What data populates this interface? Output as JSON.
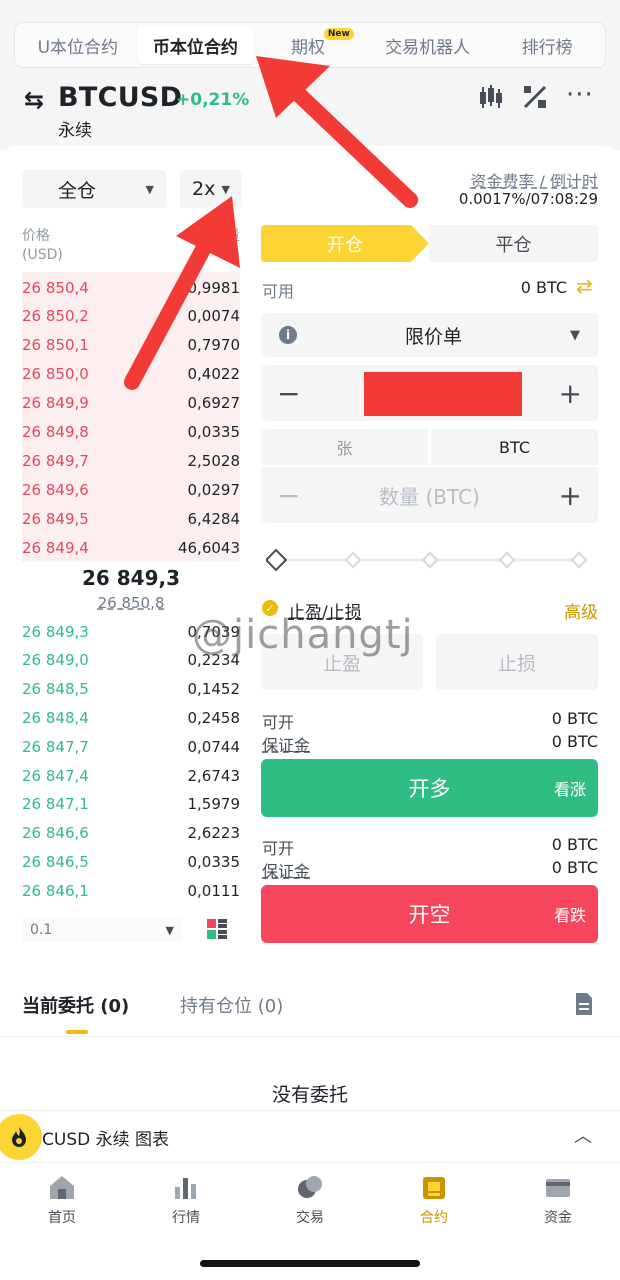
{
  "tabs": [
    {
      "label": "U本位合约",
      "active": false
    },
    {
      "label": "币本位合约",
      "active": true
    },
    {
      "label": "期权",
      "active": false,
      "badge": "New"
    },
    {
      "label": "交易机器人",
      "active": false
    },
    {
      "label": "排行榜",
      "active": false
    }
  ],
  "header": {
    "symbol": "BTCUSD",
    "change": "+0,21%",
    "subtitle": "永续",
    "icons": [
      "candlestick-icon",
      "percent-icon",
      "more-icon"
    ]
  },
  "left": {
    "margin_mode": "全仓",
    "leverage": "2x",
    "price_header": "价格",
    "price_unit": "(USD)",
    "qty_header_visible": "量",
    "qty_unit_visible": "C)",
    "asks": [
      {
        "price": "26 850,4",
        "qty": "0,9981"
      },
      {
        "price": "26 850,2",
        "qty": "0,0074"
      },
      {
        "price": "26 850,1",
        "qty": "0,7970"
      },
      {
        "price": "26 850,0",
        "qty": "0,4022"
      },
      {
        "price": "26 849,9",
        "qty": "0,6927"
      },
      {
        "price": "26 849,8",
        "qty": "0,0335"
      },
      {
        "price": "26 849,7",
        "qty": "2,5028"
      },
      {
        "price": "26 849,6",
        "qty": "0,0297"
      },
      {
        "price": "26 849,5",
        "qty": "6,4284"
      },
      {
        "price": "26 849,4",
        "qty": "46,6043"
      }
    ],
    "last_price": "26 849,3",
    "mark_price": "26 850,8",
    "bids": [
      {
        "price": "26 849,3",
        "qty": "0,7039"
      },
      {
        "price": "26 849,0",
        "qty": "0,2234"
      },
      {
        "price": "26 848,5",
        "qty": "0,1452"
      },
      {
        "price": "26 848,4",
        "qty": "0,2458"
      },
      {
        "price": "26 847,7",
        "qty": "0,0744"
      },
      {
        "price": "26 847,4",
        "qty": "2,6743"
      },
      {
        "price": "26 847,1",
        "qty": "1,5979"
      },
      {
        "price": "26 846,6",
        "qty": "2,6223"
      },
      {
        "price": "26 846,5",
        "qty": "0,0335"
      },
      {
        "price": "26 846,1",
        "qty": "0,0111"
      }
    ],
    "precision": "0.1"
  },
  "right": {
    "funding_label": "资金费率 / 倒计时",
    "funding_value": "0.0017%/07:08:29",
    "open_tab": "开仓",
    "close_tab": "平仓",
    "available_label": "可用",
    "available_value": "0 BTC",
    "order_type": "限价单",
    "minus": "−",
    "plus": "+",
    "unit_left": "张",
    "unit_right": "BTC",
    "qty_placeholder": "数量 (BTC)",
    "tpsl_label": "止盈/止损",
    "advanced": "高级",
    "tp": "止盈",
    "sl": "止损",
    "long_can_open_label": "可开",
    "long_can_open_value": "0 BTC",
    "long_margin_label": "保证金",
    "long_margin_value": "0 BTC",
    "long_btn": "开多",
    "long_sub": "看涨",
    "short_can_open_label": "可开",
    "short_can_open_value": "0 BTC",
    "short_margin_label": "保证金",
    "short_margin_value": "0 BTC",
    "short_btn": "开空",
    "short_sub": "看跌"
  },
  "orders": {
    "tab_current": "当前委托 (0)",
    "tab_positions": "持有仓位 (0)",
    "empty": "没有委托"
  },
  "sticky": {
    "text": "CUSD 永续  图表"
  },
  "nav": [
    {
      "label": "首页",
      "icon": "home-icon",
      "active": false
    },
    {
      "label": "行情",
      "icon": "markets-icon",
      "active": false
    },
    {
      "label": "交易",
      "icon": "trade-icon",
      "active": false
    },
    {
      "label": "合约",
      "icon": "futures-icon",
      "active": true
    },
    {
      "label": "资金",
      "icon": "wallet-icon",
      "active": false
    }
  ],
  "watermark": "@jichangtj",
  "colors": {
    "accent": "#fcd535",
    "buy": "#2ebd85",
    "sell": "#f6465d",
    "annotation_arrow": "#f23a36"
  }
}
